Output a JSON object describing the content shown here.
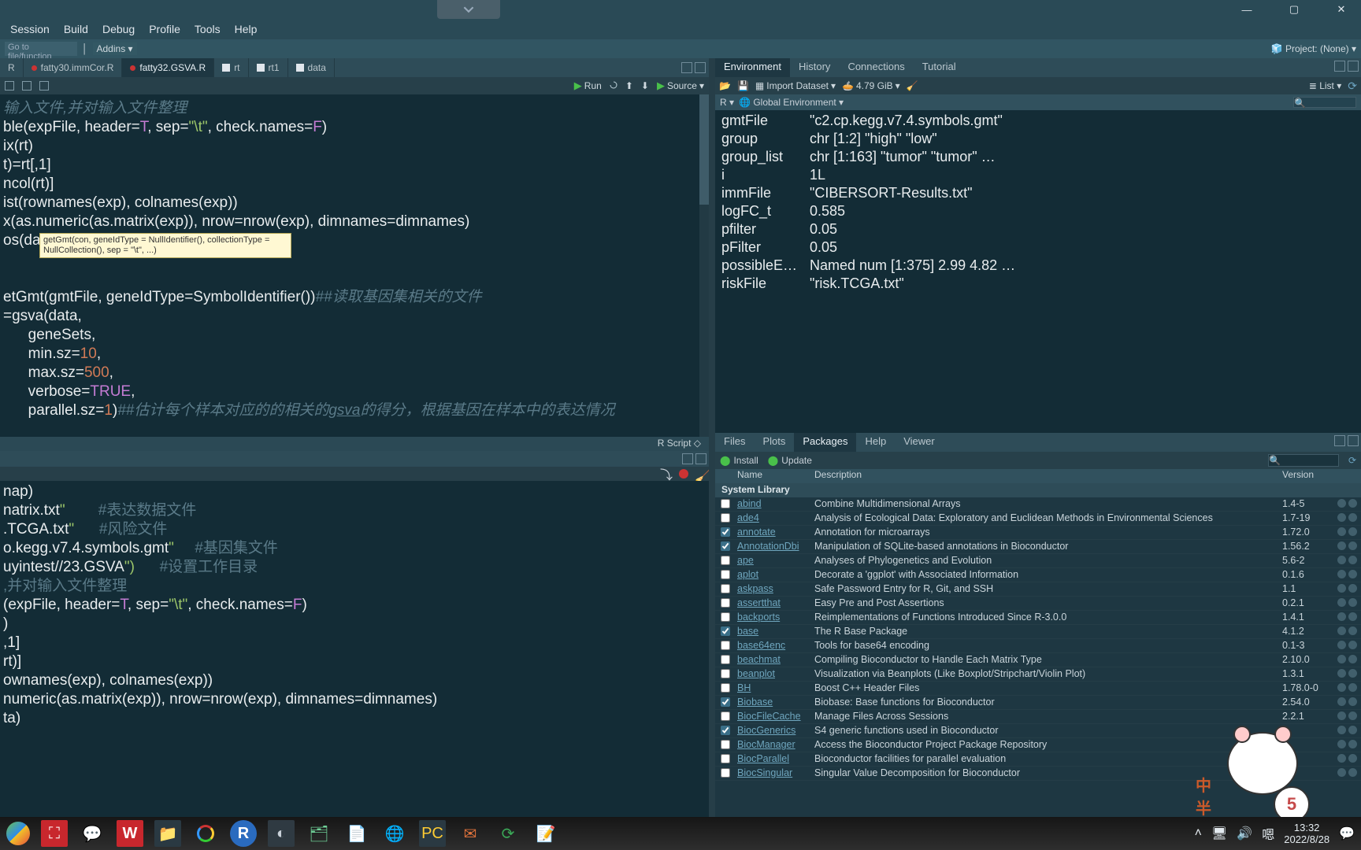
{
  "window": {
    "minimize": "—",
    "maximize": "▢",
    "close": "✕"
  },
  "menu": [
    "Tools_partial",
    "Session",
    "Build",
    "Debug",
    "Profile",
    "Tools",
    "Help"
  ],
  "toolbar": {
    "goto_placeholder": "Go to file/function",
    "addins": "Addins",
    "project": "Project: (None)"
  },
  "editor_tabs": [
    {
      "label": "R",
      "kind": "cut"
    },
    {
      "label": "fatty30.immCor.R",
      "kind": "file",
      "dirty": true
    },
    {
      "label": "fatty32.GSVA.R",
      "kind": "file",
      "active": true,
      "dirty": true
    },
    {
      "label": "rt",
      "kind": "grid"
    },
    {
      "label": "rt1",
      "kind": "grid"
    },
    {
      "label": "data",
      "kind": "grid"
    }
  ],
  "src_toolbar": {
    "run": "Run",
    "source": "Source"
  },
  "code_hint": "getGmt(con, geneIdType = NullIdentifier(), collectionType = NullCollection(), sep = \"\\t\", ...)",
  "code_lines": [
    {
      "t": "comment",
      "txt": "输入文件,并对输入文件整理"
    },
    {
      "t": "mix",
      "parts": [
        [
          "ident",
          "ble(expFile, header="
        ],
        [
          "bool",
          "T"
        ],
        [
          "ident",
          ", sep="
        ],
        [
          "str",
          "\"\\t\""
        ],
        [
          "ident",
          ", check.names="
        ],
        [
          "bool",
          "F"
        ],
        [
          "ident",
          ")"
        ]
      ]
    },
    {
      "t": "ident",
      "txt": "ix(rt)"
    },
    {
      "t": "ident",
      "txt": "t)=rt[,1]"
    },
    {
      "t": "ident",
      "txt": "ncol(rt)]"
    },
    {
      "t": "ident",
      "txt": "ist(rownames(exp), colnames(exp))"
    },
    {
      "t": "ident",
      "txt": "x(as.numeric(as.matrix(exp)), nrow=nrow(exp), dimnames=dimnames)"
    },
    {
      "t": "ident",
      "txt": "os(data)"
    },
    {
      "t": "blank",
      "txt": ""
    },
    {
      "t": "blank",
      "txt": ""
    },
    {
      "t": "mix",
      "parts": [
        [
          "ident",
          "etGmt(gmtFile, geneIdType=SymbolIdentifier())"
        ],
        [
          "comment",
          "##读取基因集相关的文件"
        ]
      ]
    },
    {
      "t": "ident",
      "txt": "=gsva(data,"
    },
    {
      "t": "ident",
      "txt": "      geneSets,"
    },
    {
      "t": "mix",
      "parts": [
        [
          "ident",
          "      min.sz="
        ],
        [
          "num",
          "10"
        ],
        [
          "ident",
          ","
        ]
      ]
    },
    {
      "t": "mix",
      "parts": [
        [
          "ident",
          "      max.sz="
        ],
        [
          "num",
          "500"
        ],
        [
          "ident",
          ","
        ]
      ]
    },
    {
      "t": "mix",
      "parts": [
        [
          "ident",
          "      verbose="
        ],
        [
          "bool",
          "TRUE"
        ],
        [
          "ident",
          ","
        ]
      ]
    },
    {
      "t": "mix",
      "parts": [
        [
          "ident",
          "      parallel.sz="
        ],
        [
          "num",
          "1"
        ],
        [
          "ident",
          ")"
        ],
        [
          "comment",
          "##估计每个样本对应的的相关的"
        ],
        [
          "comment it",
          "gsva"
        ],
        [
          "comment",
          "的得分，根据基因在样本中的表达情况"
        ]
      ]
    }
  ],
  "code_status": "R Script",
  "console_lines": [
    {
      "t": "ident",
      "txt": "nap)"
    },
    {
      "t": "mix",
      "parts": [
        [
          "ident",
          "natrix.txt"
        ],
        [
          "str",
          "\""
        ],
        [
          "ident",
          "        "
        ],
        [
          "comment",
          "#表达数据文件"
        ]
      ]
    },
    {
      "t": "mix",
      "parts": [
        [
          "ident",
          ".TCGA.txt"
        ],
        [
          "str",
          "\""
        ],
        [
          "ident",
          "      "
        ],
        [
          "comment",
          "#风险文件"
        ]
      ]
    },
    {
      "t": "mix",
      "parts": [
        [
          "ident",
          "o.kegg.v7.4.symbols.gmt"
        ],
        [
          "str",
          "\""
        ],
        [
          "ident",
          "     "
        ],
        [
          "comment",
          "#基因集文件"
        ]
      ]
    },
    {
      "t": "mix",
      "parts": [
        [
          "ident",
          "uyintest//23.GSVA"
        ],
        [
          "str",
          "\")"
        ],
        [
          "ident",
          "      "
        ],
        [
          "comment",
          "#设置工作目录"
        ]
      ]
    },
    {
      "t": "comment",
      "txt": ",并对输入文件整理"
    },
    {
      "t": "mix",
      "parts": [
        [
          "ident",
          "(expFile, header="
        ],
        [
          "bool",
          "T"
        ],
        [
          "ident",
          ", sep="
        ],
        [
          "str",
          "\"\\t\""
        ],
        [
          "ident",
          ", check.names="
        ],
        [
          "bool",
          "F"
        ],
        [
          "ident",
          ")"
        ]
      ]
    },
    {
      "t": "ident",
      "txt": ")"
    },
    {
      "t": "ident",
      "txt": ",1]"
    },
    {
      "t": "ident",
      "txt": "rt)]"
    },
    {
      "t": "ident",
      "txt": "ownames(exp), colnames(exp))"
    },
    {
      "t": "ident",
      "txt": "numeric(as.matrix(exp)), nrow=nrow(exp), dimnames=dimnames)"
    },
    {
      "t": "ident",
      "txt": "ta)"
    }
  ],
  "env_tabs": [
    "Environment",
    "History",
    "Connections",
    "Tutorial"
  ],
  "env_toolbar": {
    "import": "Import Dataset",
    "mem": "4.79 GiB",
    "list": "List"
  },
  "env_scope": {
    "lang": "R",
    "scope": "Global Environment"
  },
  "env_rows": [
    {
      "name": "gmtFile",
      "val": "\"c2.cp.kegg.v7.4.symbols.gmt\""
    },
    {
      "name": "group",
      "val": "chr [1:2] \"high\" \"low\""
    },
    {
      "name": "group_list",
      "val": "chr [1:163] \"tumor\" \"tumor\" …"
    },
    {
      "name": "i",
      "val": "1L"
    },
    {
      "name": "immFile",
      "val": "\"CIBERSORT-Results.txt\""
    },
    {
      "name": "logFC_t",
      "val": "0.585"
    },
    {
      "name": "pfilter",
      "val": "0.05"
    },
    {
      "name": "pFilter",
      "val": "0.05"
    },
    {
      "name": "possibleE…",
      "val": "Named num [1:375] 2.99 4.82 …"
    },
    {
      "name": "riskFile",
      "val": "\"risk.TCGA.txt\""
    }
  ],
  "pkg_tabs": [
    "Files",
    "Plots",
    "Packages",
    "Help",
    "Viewer"
  ],
  "pkg_toolbar": {
    "install": "Install",
    "update": "Update"
  },
  "pkg_header": {
    "name": "Name",
    "desc": "Description",
    "version": "Version"
  },
  "pkg_section": "System Library",
  "packages": [
    {
      "chk": false,
      "name": "abind",
      "desc": "Combine Multidimensional Arrays",
      "ver": "1.4-5"
    },
    {
      "chk": false,
      "name": "ade4",
      "desc": "Analysis of Ecological Data: Exploratory and Euclidean Methods in Environmental Sciences",
      "ver": "1.7-19"
    },
    {
      "chk": true,
      "name": "annotate",
      "desc": "Annotation for microarrays",
      "ver": "1.72.0"
    },
    {
      "chk": true,
      "name": "AnnotationDbi",
      "desc": "Manipulation of SQLite-based annotations in Bioconductor",
      "ver": "1.56.2"
    },
    {
      "chk": false,
      "name": "ape",
      "desc": "Analyses of Phylogenetics and Evolution",
      "ver": "5.6-2"
    },
    {
      "chk": false,
      "name": "aplot",
      "desc": "Decorate a 'ggplot' with Associated Information",
      "ver": "0.1.6"
    },
    {
      "chk": false,
      "name": "askpass",
      "desc": "Safe Password Entry for R, Git, and SSH",
      "ver": "1.1"
    },
    {
      "chk": false,
      "name": "assertthat",
      "desc": "Easy Pre and Post Assertions",
      "ver": "0.2.1"
    },
    {
      "chk": false,
      "name": "backports",
      "desc": "Reimplementations of Functions Introduced Since R-3.0.0",
      "ver": "1.4.1"
    },
    {
      "chk": true,
      "name": "base",
      "desc": "The R Base Package",
      "ver": "4.1.2"
    },
    {
      "chk": false,
      "name": "base64enc",
      "desc": "Tools for base64 encoding",
      "ver": "0.1-3"
    },
    {
      "chk": false,
      "name": "beachmat",
      "desc": "Compiling Bioconductor to Handle Each Matrix Type",
      "ver": "2.10.0"
    },
    {
      "chk": false,
      "name": "beanplot",
      "desc": "Visualization via Beanplots (Like Boxplot/Stripchart/Violin Plot)",
      "ver": "1.3.1"
    },
    {
      "chk": false,
      "name": "BH",
      "desc": "Boost C++ Header Files",
      "ver": "1.78.0-0"
    },
    {
      "chk": true,
      "name": "Biobase",
      "desc": "Biobase: Base functions for Bioconductor",
      "ver": "2.54.0"
    },
    {
      "chk": false,
      "name": "BiocFileCache",
      "desc": "Manage Files Across Sessions",
      "ver": "2.2.1"
    },
    {
      "chk": true,
      "name": "BiocGenerics",
      "desc": "S4 generic functions used in Bioconductor",
      "ver": ""
    },
    {
      "chk": false,
      "name": "BiocManager",
      "desc": "Access the Bioconductor Project Package Repository",
      "ver": ""
    },
    {
      "chk": false,
      "name": "BiocParallel",
      "desc": "Bioconductor facilities for parallel evaluation",
      "ver": ""
    },
    {
      "chk": false,
      "name": "BiocSingular",
      "desc": "Singular Value Decomposition for Bioconductor",
      "ver": ""
    }
  ],
  "taskbar": {
    "time": "13:32",
    "date": "2022/8/28"
  },
  "mascot": {
    "txt1": "中",
    "txt2": "半",
    "badge": "5"
  }
}
